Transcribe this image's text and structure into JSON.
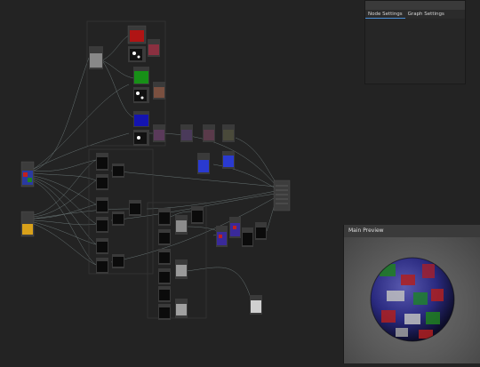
{
  "settings": {
    "tabs": [
      {
        "label": "Node Settings",
        "active": true
      },
      {
        "label": "Graph Settings",
        "active": false
      }
    ]
  },
  "preview": {
    "title": "Main Preview"
  },
  "colors": {
    "accent": "#4a8fd6",
    "canvas": "#232323",
    "wire": "#7f8f8f"
  }
}
